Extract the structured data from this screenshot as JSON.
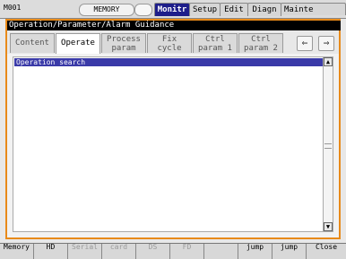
{
  "status": {
    "code": "M001",
    "mode": "MEMORY"
  },
  "top_tabs": [
    {
      "label": "Monitr",
      "active": true
    },
    {
      "label": "Setup",
      "active": false
    },
    {
      "label": "Edit",
      "active": false
    },
    {
      "label": "Diagn",
      "active": false
    },
    {
      "label": "Mainte",
      "active": false
    }
  ],
  "window": {
    "title": "Operation/Parameter/Alarm Guidance"
  },
  "tabs": [
    {
      "line1": "Content",
      "line2": "",
      "selected": false
    },
    {
      "line1": "Operate",
      "line2": "",
      "selected": true
    },
    {
      "line1": "Process",
      "line2": "param",
      "selected": false
    },
    {
      "line1": "Fix",
      "line2": "cycle",
      "selected": false
    },
    {
      "line1": "Ctrl",
      "line2": "param 1",
      "selected": false
    },
    {
      "line1": "Ctrl",
      "line2": "param 2",
      "selected": false
    }
  ],
  "nav": {
    "prev_symbol": "⇐",
    "next_symbol": "⇒"
  },
  "list": {
    "header": "Operation search",
    "scroll_up": "▲",
    "scroll_down": "▼"
  },
  "function_keys": [
    {
      "label": "Memory",
      "label2": "",
      "enabled": true
    },
    {
      "label": "HD",
      "label2": "",
      "enabled": true
    },
    {
      "label": "Serial",
      "label2": "",
      "enabled": false
    },
    {
      "label": "",
      "label2": "card",
      "enabled": false
    },
    {
      "label": "DS",
      "label2": "",
      "enabled": false
    },
    {
      "label": "FD",
      "label2": "",
      "enabled": false
    },
    {
      "label": "",
      "label2": "",
      "enabled": false
    },
    {
      "label": "",
      "label2": "jump",
      "enabled": true
    },
    {
      "label": "",
      "label2": "jump",
      "enabled": true
    },
    {
      "label": "Close",
      "label2": "",
      "enabled": true
    }
  ]
}
